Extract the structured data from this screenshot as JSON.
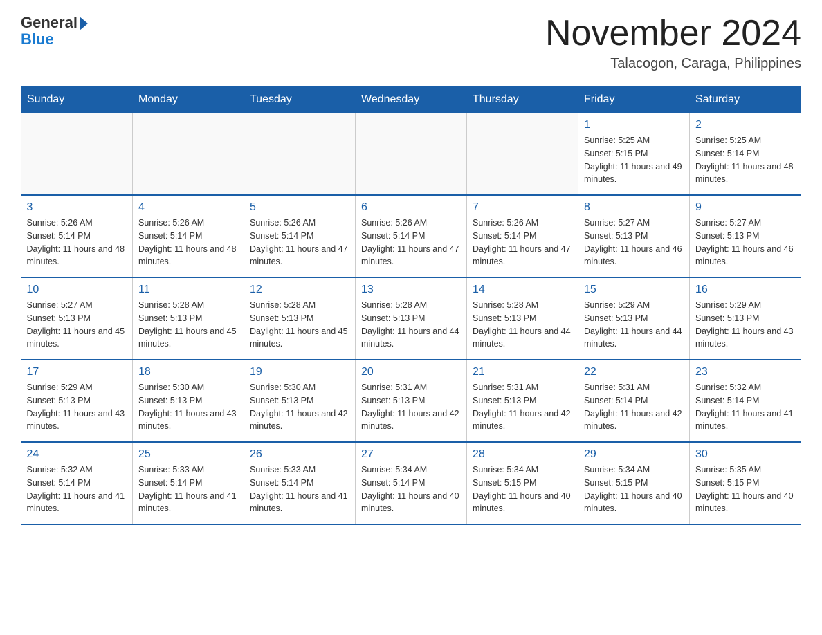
{
  "logo": {
    "general": "General",
    "blue": "Blue"
  },
  "title": "November 2024",
  "location": "Talacogon, Caraga, Philippines",
  "weekdays": [
    "Sunday",
    "Monday",
    "Tuesday",
    "Wednesday",
    "Thursday",
    "Friday",
    "Saturday"
  ],
  "weeks": [
    [
      {
        "day": "",
        "info": ""
      },
      {
        "day": "",
        "info": ""
      },
      {
        "day": "",
        "info": ""
      },
      {
        "day": "",
        "info": ""
      },
      {
        "day": "",
        "info": ""
      },
      {
        "day": "1",
        "info": "Sunrise: 5:25 AM\nSunset: 5:15 PM\nDaylight: 11 hours and 49 minutes."
      },
      {
        "day": "2",
        "info": "Sunrise: 5:25 AM\nSunset: 5:14 PM\nDaylight: 11 hours and 48 minutes."
      }
    ],
    [
      {
        "day": "3",
        "info": "Sunrise: 5:26 AM\nSunset: 5:14 PM\nDaylight: 11 hours and 48 minutes."
      },
      {
        "day": "4",
        "info": "Sunrise: 5:26 AM\nSunset: 5:14 PM\nDaylight: 11 hours and 48 minutes."
      },
      {
        "day": "5",
        "info": "Sunrise: 5:26 AM\nSunset: 5:14 PM\nDaylight: 11 hours and 47 minutes."
      },
      {
        "day": "6",
        "info": "Sunrise: 5:26 AM\nSunset: 5:14 PM\nDaylight: 11 hours and 47 minutes."
      },
      {
        "day": "7",
        "info": "Sunrise: 5:26 AM\nSunset: 5:14 PM\nDaylight: 11 hours and 47 minutes."
      },
      {
        "day": "8",
        "info": "Sunrise: 5:27 AM\nSunset: 5:13 PM\nDaylight: 11 hours and 46 minutes."
      },
      {
        "day": "9",
        "info": "Sunrise: 5:27 AM\nSunset: 5:13 PM\nDaylight: 11 hours and 46 minutes."
      }
    ],
    [
      {
        "day": "10",
        "info": "Sunrise: 5:27 AM\nSunset: 5:13 PM\nDaylight: 11 hours and 45 minutes."
      },
      {
        "day": "11",
        "info": "Sunrise: 5:28 AM\nSunset: 5:13 PM\nDaylight: 11 hours and 45 minutes."
      },
      {
        "day": "12",
        "info": "Sunrise: 5:28 AM\nSunset: 5:13 PM\nDaylight: 11 hours and 45 minutes."
      },
      {
        "day": "13",
        "info": "Sunrise: 5:28 AM\nSunset: 5:13 PM\nDaylight: 11 hours and 44 minutes."
      },
      {
        "day": "14",
        "info": "Sunrise: 5:28 AM\nSunset: 5:13 PM\nDaylight: 11 hours and 44 minutes."
      },
      {
        "day": "15",
        "info": "Sunrise: 5:29 AM\nSunset: 5:13 PM\nDaylight: 11 hours and 44 minutes."
      },
      {
        "day": "16",
        "info": "Sunrise: 5:29 AM\nSunset: 5:13 PM\nDaylight: 11 hours and 43 minutes."
      }
    ],
    [
      {
        "day": "17",
        "info": "Sunrise: 5:29 AM\nSunset: 5:13 PM\nDaylight: 11 hours and 43 minutes."
      },
      {
        "day": "18",
        "info": "Sunrise: 5:30 AM\nSunset: 5:13 PM\nDaylight: 11 hours and 43 minutes."
      },
      {
        "day": "19",
        "info": "Sunrise: 5:30 AM\nSunset: 5:13 PM\nDaylight: 11 hours and 42 minutes."
      },
      {
        "day": "20",
        "info": "Sunrise: 5:31 AM\nSunset: 5:13 PM\nDaylight: 11 hours and 42 minutes."
      },
      {
        "day": "21",
        "info": "Sunrise: 5:31 AM\nSunset: 5:13 PM\nDaylight: 11 hours and 42 minutes."
      },
      {
        "day": "22",
        "info": "Sunrise: 5:31 AM\nSunset: 5:14 PM\nDaylight: 11 hours and 42 minutes."
      },
      {
        "day": "23",
        "info": "Sunrise: 5:32 AM\nSunset: 5:14 PM\nDaylight: 11 hours and 41 minutes."
      }
    ],
    [
      {
        "day": "24",
        "info": "Sunrise: 5:32 AM\nSunset: 5:14 PM\nDaylight: 11 hours and 41 minutes."
      },
      {
        "day": "25",
        "info": "Sunrise: 5:33 AM\nSunset: 5:14 PM\nDaylight: 11 hours and 41 minutes."
      },
      {
        "day": "26",
        "info": "Sunrise: 5:33 AM\nSunset: 5:14 PM\nDaylight: 11 hours and 41 minutes."
      },
      {
        "day": "27",
        "info": "Sunrise: 5:34 AM\nSunset: 5:14 PM\nDaylight: 11 hours and 40 minutes."
      },
      {
        "day": "28",
        "info": "Sunrise: 5:34 AM\nSunset: 5:15 PM\nDaylight: 11 hours and 40 minutes."
      },
      {
        "day": "29",
        "info": "Sunrise: 5:34 AM\nSunset: 5:15 PM\nDaylight: 11 hours and 40 minutes."
      },
      {
        "day": "30",
        "info": "Sunrise: 5:35 AM\nSunset: 5:15 PM\nDaylight: 11 hours and 40 minutes."
      }
    ]
  ]
}
